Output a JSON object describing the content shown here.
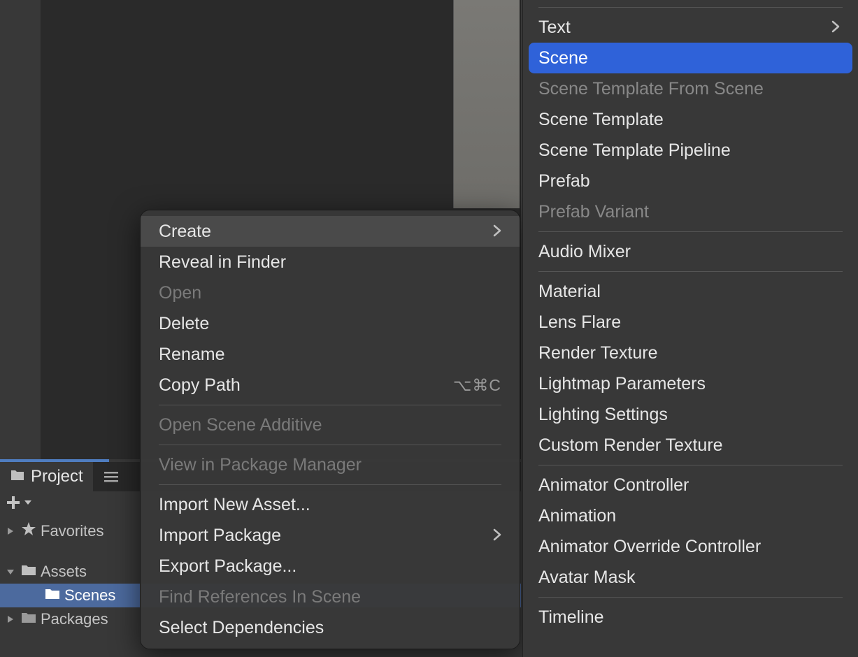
{
  "project_panel": {
    "tab_label": "Project",
    "tree": {
      "favorites": "Favorites",
      "assets": "Assets",
      "scenes": "Scenes",
      "packages": "Packages"
    }
  },
  "context_menu": {
    "create": "Create",
    "reveal": "Reveal in Finder",
    "open": "Open",
    "delete": "Delete",
    "rename": "Rename",
    "copy_path": "Copy Path",
    "copy_path_shortcut": "⌥⌘C",
    "open_scene_additive": "Open Scene Additive",
    "view_pkg_mgr": "View in Package Manager",
    "import_new_asset": "Import New Asset...",
    "import_package": "Import Package",
    "export_package": "Export Package...",
    "find_refs": "Find References In Scene",
    "select_deps": "Select Dependencies"
  },
  "create_submenu": {
    "text": "Text",
    "scene": "Scene",
    "scene_template_from_scene": "Scene Template From Scene",
    "scene_template": "Scene Template",
    "scene_template_pipeline": "Scene Template Pipeline",
    "prefab": "Prefab",
    "prefab_variant": "Prefab Variant",
    "audio_mixer": "Audio Mixer",
    "material": "Material",
    "lens_flare": "Lens Flare",
    "render_texture": "Render Texture",
    "lightmap_params": "Lightmap Parameters",
    "lighting_settings": "Lighting Settings",
    "custom_render_texture": "Custom Render Texture",
    "animator_controller": "Animator Controller",
    "animation": "Animation",
    "animator_override": "Animator Override Controller",
    "avatar_mask": "Avatar Mask",
    "timeline": "Timeline"
  }
}
